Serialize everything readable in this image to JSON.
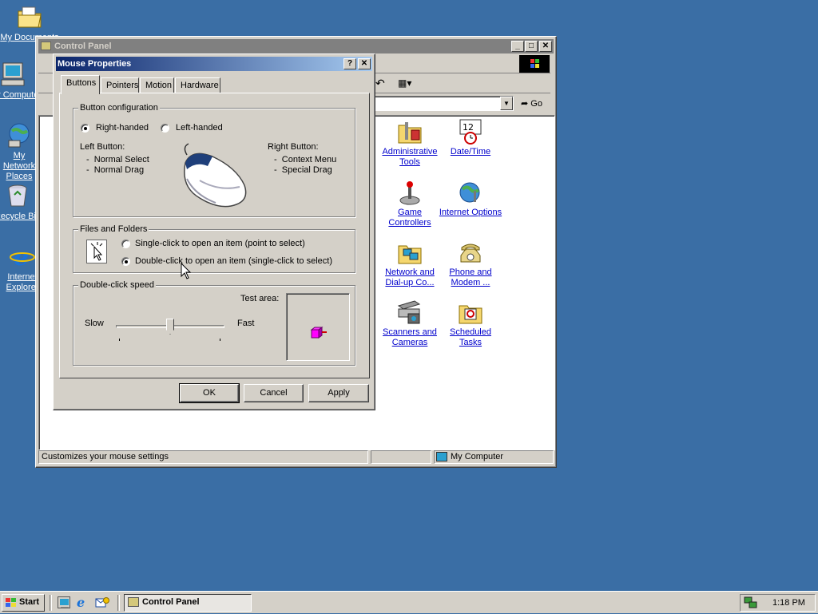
{
  "desktop": {
    "icons": [
      {
        "label": "My Documents",
        "icon": "folder-icon"
      },
      {
        "label": "My Computer",
        "icon": "computer-icon"
      },
      {
        "label": "My Network Places",
        "icon": "network-icon"
      },
      {
        "label": "Recycle Bin",
        "icon": "recycle-bin-icon"
      },
      {
        "label": "Internet Explorer",
        "icon": "ie-icon"
      }
    ]
  },
  "control_panel": {
    "title": "Control Panel",
    "items": [
      {
        "label": "Administrative Tools",
        "icon": "admin-tools-icon"
      },
      {
        "label": "Date/Time",
        "icon": "clock-icon"
      },
      {
        "label": "Game Controllers",
        "icon": "joystick-icon"
      },
      {
        "label": "Internet Options",
        "icon": "globe-icon"
      },
      {
        "label": "Network and Dial-up Co...",
        "icon": "network-folder-icon"
      },
      {
        "label": "Phone and Modem ...",
        "icon": "phone-icon"
      },
      {
        "label": "Scanners and Cameras",
        "icon": "scanner-icon"
      },
      {
        "label": "Scheduled Tasks",
        "icon": "scheduled-tasks-icon"
      }
    ],
    "go_label": "Go",
    "status": {
      "text": "Customizes your mouse settings",
      "zone": "My Computer"
    }
  },
  "dialog": {
    "title": "Mouse Properties",
    "help": "?",
    "close": "✕",
    "tabs": [
      "Buttons",
      "Pointers",
      "Motion",
      "Hardware"
    ],
    "button_config": {
      "legend": "Button configuration",
      "right_handed": "Right-handed",
      "left_handed": "Left-handed",
      "selected": "Right-handed",
      "left_button_title": "Left Button:",
      "left_button_items": [
        "Normal Select",
        "Normal Drag"
      ],
      "right_button_title": "Right Button:",
      "right_button_items": [
        "Context Menu",
        "Special Drag"
      ]
    },
    "files_folders": {
      "legend": "Files and Folders",
      "single_click": "Single-click to open an item (point to select)",
      "double_click": "Double-click to open an item (single-click to select)",
      "selected": "double"
    },
    "double_click_speed": {
      "legend": "Double-click speed",
      "slow": "Slow",
      "fast": "Fast",
      "test_area": "Test area:",
      "slider_value": 0.5
    },
    "buttons": {
      "ok": "OK",
      "cancel": "Cancel",
      "apply": "Apply"
    }
  },
  "taskbar": {
    "start": "Start",
    "tasks": [
      {
        "label": "Control Panel",
        "active": true
      }
    ],
    "clock": "1:18 PM"
  }
}
